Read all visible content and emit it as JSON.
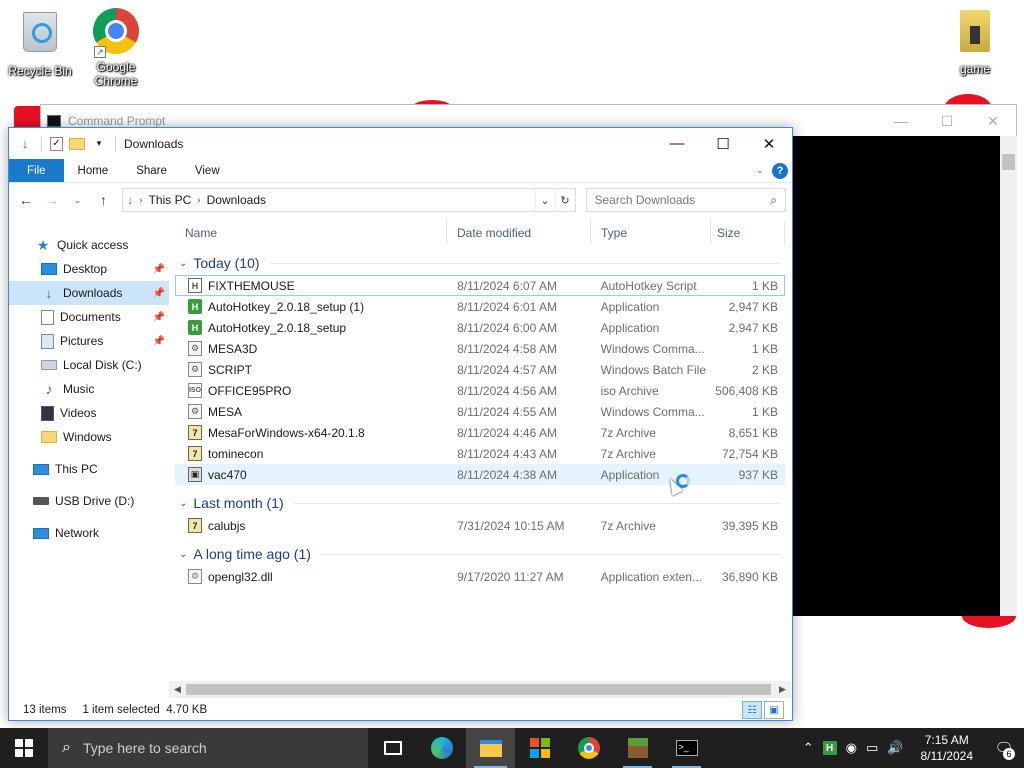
{
  "desktop": {
    "icons": [
      {
        "label": "Recycle Bin",
        "icon": "recycle-bin-icon"
      },
      {
        "label": "Google Chrome",
        "icon": "chrome-icon"
      },
      {
        "label": "game",
        "icon": "folder-icon"
      }
    ]
  },
  "cmd_window": {
    "title": "Command Prompt",
    "controls": {
      "minimize": "—",
      "maximize": "☐",
      "close": "✕"
    }
  },
  "explorer": {
    "title": "Downloads",
    "controls": {
      "minimize": "—",
      "maximize": "☐",
      "close": "✕"
    },
    "ribbon": {
      "file": "File",
      "home": "Home",
      "share": "Share",
      "view": "View"
    },
    "address": {
      "crumbs": [
        "This PC",
        "Downloads"
      ]
    },
    "search": {
      "placeholder": "Search Downloads"
    },
    "nav": {
      "quick_access": "Quick access",
      "desktop": "Desktop",
      "downloads": "Downloads",
      "documents": "Documents",
      "pictures": "Pictures",
      "local_disk": "Local Disk (C:)",
      "music": "Music",
      "videos": "Videos",
      "windows": "Windows",
      "this_pc": "This PC",
      "usb": "USB Drive (D:)",
      "network": "Network"
    },
    "columns": {
      "name": "Name",
      "date": "Date modified",
      "type": "Type",
      "size": "Size"
    },
    "groups": [
      {
        "label": "Today (10)",
        "files": [
          {
            "name": "FIXTHEMOUSE",
            "date": "8/11/2024 6:07 AM",
            "type": "AutoHotkey Script",
            "size": "1 KB",
            "icon": "ahk-script-icon"
          },
          {
            "name": "AutoHotkey_2.0.18_setup (1)",
            "date": "8/11/2024 6:01 AM",
            "type": "Application",
            "size": "2,947 KB",
            "icon": "autohotkey-icon"
          },
          {
            "name": "AutoHotkey_2.0.18_setup",
            "date": "8/11/2024 6:00 AM",
            "type": "Application",
            "size": "2,947 KB",
            "icon": "autohotkey-icon"
          },
          {
            "name": "MESA3D",
            "date": "8/11/2024 4:58 AM",
            "type": "Windows Comma...",
            "size": "1 KB",
            "icon": "cmd-file-icon"
          },
          {
            "name": "SCRIPT",
            "date": "8/11/2024 4:57 AM",
            "type": "Windows Batch File",
            "size": "2 KB",
            "icon": "cmd-file-icon"
          },
          {
            "name": "OFFICE95PRO",
            "date": "8/11/2024 4:56 AM",
            "type": "iso Archive",
            "size": "506,408 KB",
            "icon": "iso-icon"
          },
          {
            "name": "MESA",
            "date": "8/11/2024 4:55 AM",
            "type": "Windows Comma...",
            "size": "1 KB",
            "icon": "cmd-file-icon"
          },
          {
            "name": "MesaForWindows-x64-20.1.8",
            "date": "8/11/2024 4:46 AM",
            "type": "7z Archive",
            "size": "8,651 KB",
            "icon": "7z-icon"
          },
          {
            "name": "tominecon",
            "date": "8/11/2024 4:43 AM",
            "type": "7z Archive",
            "size": "72,754 KB",
            "icon": "7z-icon"
          },
          {
            "name": "vac470",
            "date": "8/11/2024 4:38 AM",
            "type": "Application",
            "size": "937 KB",
            "icon": "application-icon"
          }
        ]
      },
      {
        "label": "Last month (1)",
        "files": [
          {
            "name": "calubjs",
            "date": "7/31/2024 10:15 AM",
            "type": "7z Archive",
            "size": "39,395 KB",
            "icon": "7z-icon"
          }
        ]
      },
      {
        "label": "A long time ago (1)",
        "files": [
          {
            "name": "opengl32.dll",
            "date": "9/17/2020 11:27 AM",
            "type": "Application exten...",
            "size": "36,890 KB",
            "icon": "dll-icon"
          }
        ]
      }
    ],
    "status": {
      "count": "13 items",
      "selected": "1 item selected  4.70 KB"
    }
  },
  "taskbar": {
    "search_placeholder": "Type here to search",
    "clock_time": "7:15 AM",
    "clock_date": "8/11/2024",
    "notifications": "6"
  },
  "colors": {
    "accent": "#1979ca",
    "selection": "#cce4f7",
    "group_header": "#1e3d8a",
    "taskbar": "#1f1f1f"
  }
}
